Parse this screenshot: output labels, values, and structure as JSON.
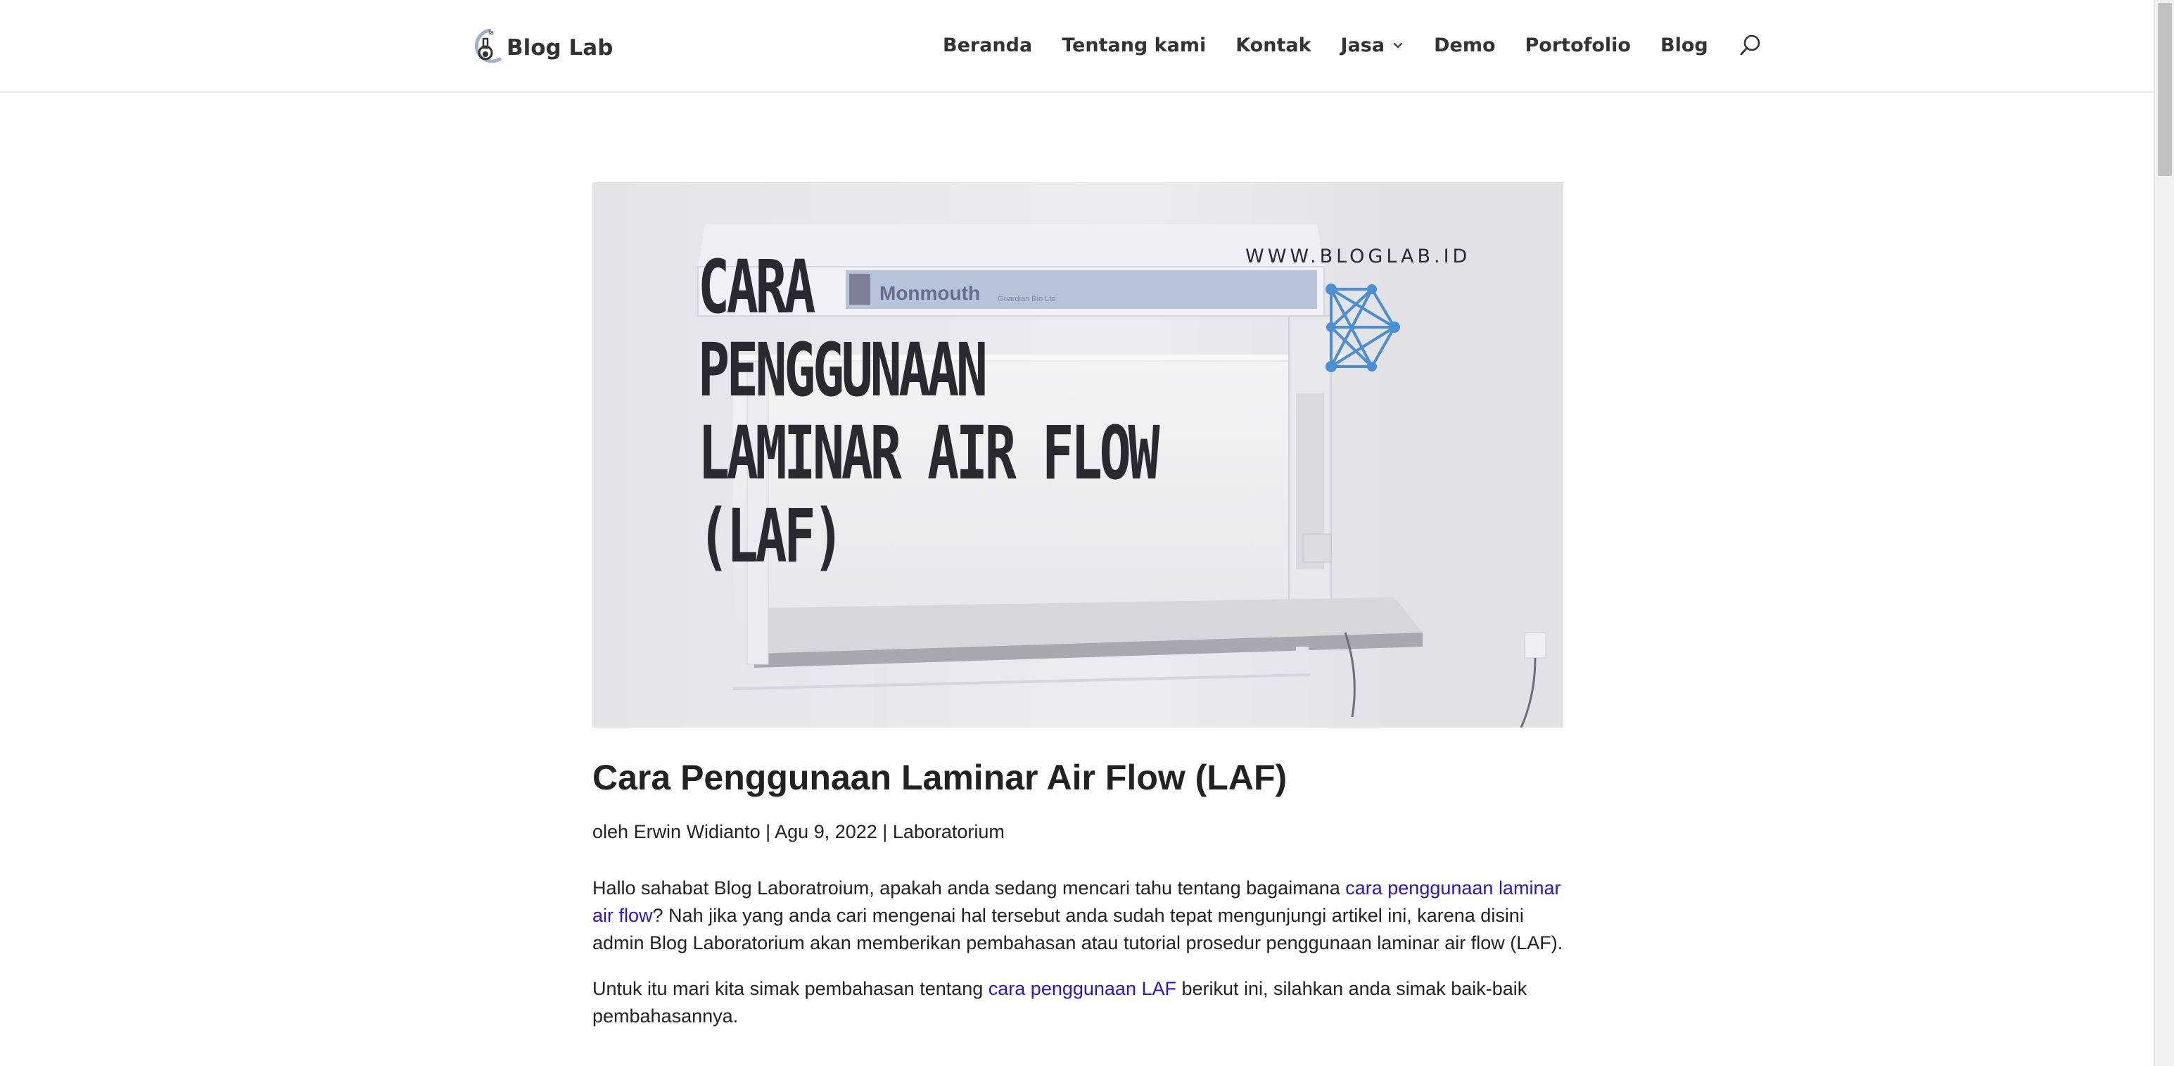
{
  "site": {
    "logo_text": "Blog Lab"
  },
  "nav": {
    "items": [
      "Beranda",
      "Tentang kami",
      "Kontak",
      "Jasa",
      "Demo",
      "Portofolio",
      "Blog"
    ]
  },
  "hero": {
    "title_lines": "CARA\nPENGGUNAAN\nLAMINAR AIR FLOW\n(LAF)",
    "site_url": "WWW.BLOGLAB.ID",
    "brand": "Monmouth",
    "brand_sub": "Guardian Bio Ltd"
  },
  "article": {
    "title": "Cara Penggunaan Laminar Air Flow (LAF)",
    "meta": {
      "prefix": "oleh ",
      "author": "Erwin Widianto",
      "sep1": " | ",
      "date": "Agu 9, 2022",
      "sep2": " | ",
      "category": "Laboratorium"
    },
    "p1": {
      "before": "Hallo sahabat Blog Laboratroium, apakah anda sedang mencari tahu tentang bagaimana ",
      "link": "cara penggunaan laminar air flow",
      "after": "? Nah jika yang anda cari mengenai hal tersebut anda sudah tepat mengunjungi artikel ini, karena disini admin Blog Laboratorium akan memberikan pembahasan atau tutorial prosedur penggunaan laminar air flow (LAF)."
    },
    "p2": {
      "before": "Untuk itu mari kita simak pembahasan tentang ",
      "link": "cara penggunaan LAF",
      "after": " berikut ini, silahkan anda simak baik-baik pembahasannya."
    }
  },
  "colors": {
    "link": "#2c13c9",
    "text": "#222222",
    "network_blue": "#4a8fd6"
  },
  "icons": {
    "search": "search-icon",
    "dropdown": "chevron-down-icon",
    "logo": "flask-logo-icon"
  }
}
